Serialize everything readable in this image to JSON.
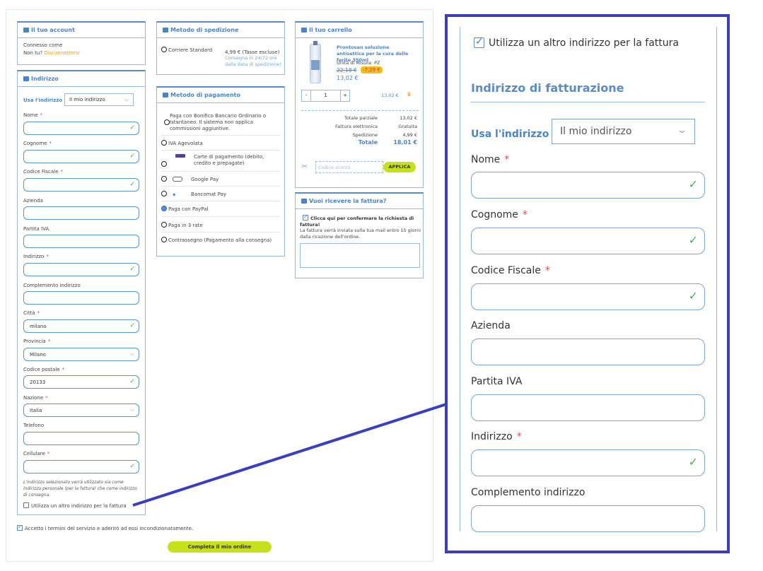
{
  "account": {
    "title": "Il tuo account",
    "connected": "Connesso come",
    "not_you": "Non tu?",
    "logout": "Disconnettersi"
  },
  "address": {
    "title": "Indirizzo",
    "use_address_label": "Usa l'indirizzo",
    "use_address_value": "Il mio indirizzo",
    "fields": {
      "nome": {
        "label": "Nome",
        "value": ""
      },
      "cognome": {
        "label": "Cognome",
        "value": ""
      },
      "codice_fiscale": {
        "label": "Codice Fiscale",
        "value": ""
      },
      "azienda": {
        "label": "Azienda",
        "value": ""
      },
      "partita_iva": {
        "label": "Partita IVA",
        "value": ""
      },
      "indirizzo": {
        "label": "Indirizzo",
        "value": ""
      },
      "complemento": {
        "label": "Complemento indirizzo",
        "value": ""
      },
      "citta": {
        "label": "Città",
        "value": "milano"
      },
      "provincia": {
        "label": "Provincia",
        "value": "Milano"
      },
      "cap": {
        "label": "Codice postale",
        "value": "20133"
      },
      "nazione": {
        "label": "Nazione",
        "value": "Italia"
      },
      "telefono": {
        "label": "Telefono",
        "value": ""
      },
      "cellulare": {
        "label": "Cellulare",
        "value": ""
      }
    },
    "note": "L'indirizzo selezionato verrà utilizzato sia come indirizzo personale (per la fattura) che come indirizzo di consegna.",
    "other_invoice_address": "Utilizza un altro indirizzo per la fattura"
  },
  "shipping": {
    "title": "Metodo di spedizione",
    "carrier": "Corriere Standard",
    "price": "4,99 € (Tasse escluse)",
    "delivery": "Consegna in 24/72 ore dalla data di spedizione!"
  },
  "payment": {
    "title": "Metodo di pagamento",
    "options": [
      "Paga con Bonifico Bancario Ordinario o Istantaneo. Il sistema non applica commissioni aggiuntive.",
      "IVA Agevolata",
      "Carte di pagamento (debito, credito e prepagate)",
      "Google Pay",
      "Bancomat Pay",
      "Paga con PayPal",
      "Paga in 3 rate",
      "Contrassegno (Pagamento alla consegna)"
    ],
    "selected_index": 5
  },
  "cart": {
    "title": "Il tuo carrello",
    "product_name": "Prontosan soluzione antisettica per la cura delle ferite 350ml",
    "unit": "Unità di Misura: PZ",
    "old_price": "22,18 €",
    "discount": "-7,29 €",
    "price": "13,02 €",
    "qty_minus": "-",
    "qty": "1",
    "qty_plus": "+",
    "line_total": "13,02 €",
    "subtotal_label": "Totale parziale",
    "subtotal": "13,02 €",
    "einvoice_label": "Fattura elettronica",
    "einvoice": "Gratuita",
    "shipping_label": "Spedizione",
    "shipping": "4,99 €",
    "total_label": "Totale",
    "total": "18,01 €",
    "coupon_placeholder": "Codice sconto",
    "apply": "APPLICA"
  },
  "invoice": {
    "title": "Vuoi ricevere la fattura?",
    "confirm": "Clicca qui per confermare la richiesta di fattura!",
    "info": "La fattura verrà inviata sulla tua mail entro 15 giorni dalla ricezione dell'ordine."
  },
  "terms": "Accetto i termini del servizio e aderirò ad essi incondizionatamente.",
  "complete_order": "Completa il mio ordine",
  "zoom": {
    "checkbox_label": "Utilizza un altro indirizzo per la fattura",
    "section_title": "Indirizzo di fatturazione",
    "use_address_label": "Usa l'indirizzo",
    "use_address_value": "Il mio indirizzo",
    "fields": [
      "Nome",
      "Cognome",
      "Codice Fiscale",
      "Azienda",
      "Partita IVA",
      "Indirizzo",
      "Complemento indirizzo"
    ]
  },
  "colors": {
    "accent": "#4a84c8",
    "callout": "#3a3fbf",
    "button": "#c6e01a",
    "required": "#e04848",
    "valid": "#4caf50"
  }
}
